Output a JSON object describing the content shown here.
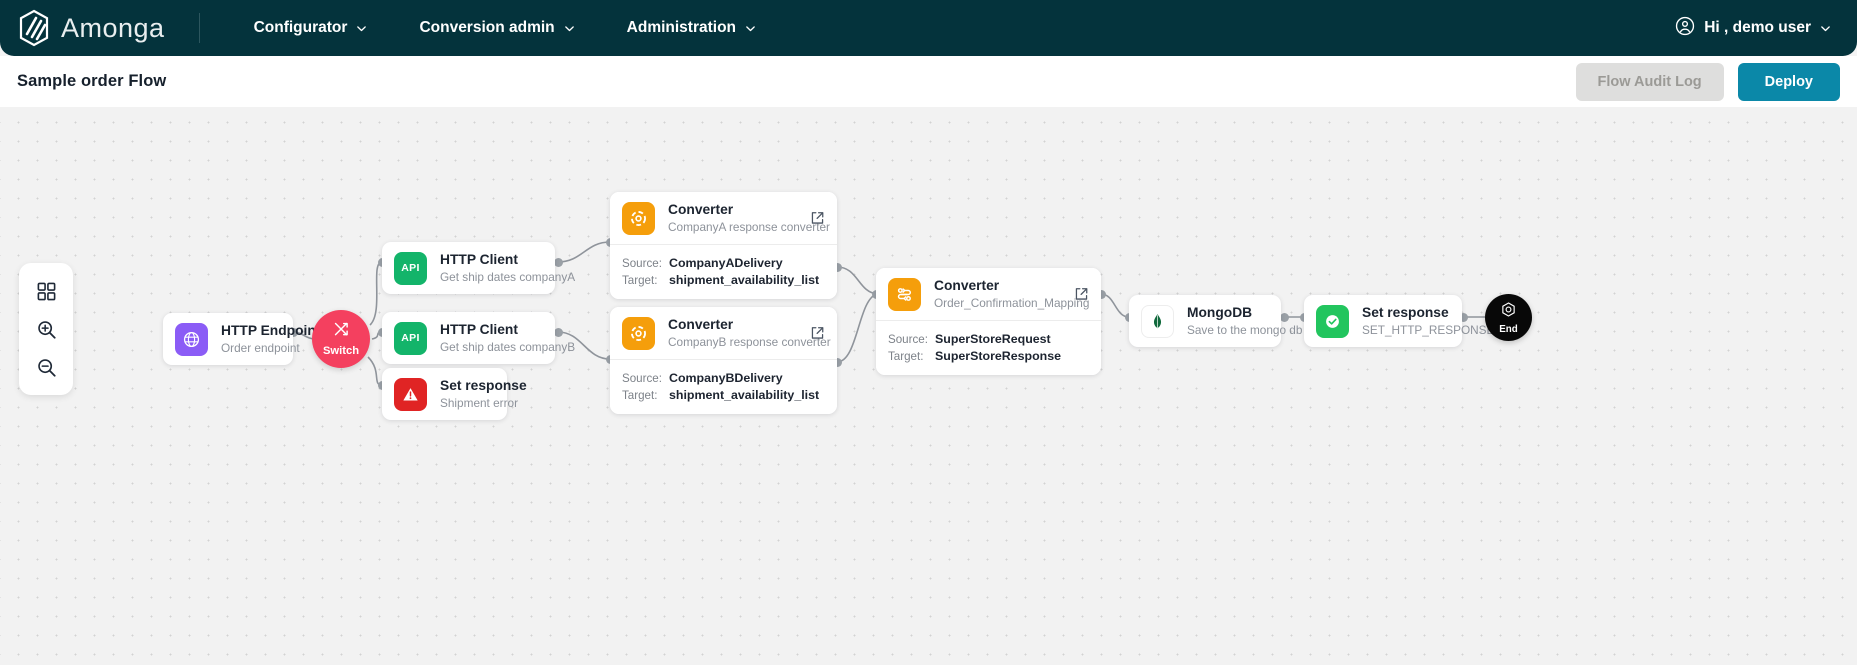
{
  "topbar": {
    "brand": "Amonga",
    "nav": [
      {
        "label": "Configurator",
        "icon": "chevron-down-icon"
      },
      {
        "label": "Conversion admin",
        "icon": "chevron-down-icon"
      },
      {
        "label": "Administration",
        "icon": "chevron-down-icon"
      }
    ],
    "user": {
      "label": "Hi , demo user",
      "icon": "user-circle-icon",
      "caret": "chevron-down-icon"
    },
    "bg_color": "#04333c"
  },
  "subheader": {
    "title": "Sample order Flow",
    "audit_label": "Flow Audit Log",
    "deploy_label": "Deploy",
    "deploy_color": "#0b88a8",
    "audit_color": "#dededd"
  },
  "tools": [
    {
      "name": "grid-icon",
      "label": "grid"
    },
    {
      "name": "zoom-in-icon",
      "label": "zoom in"
    },
    {
      "name": "zoom-out-icon",
      "label": "zoom out"
    }
  ],
  "nodes": {
    "http_endpoint": {
      "title": "HTTP Endpoint",
      "subtitle": "Order endpoint",
      "icon": "globe-icon",
      "color": "#8b5cf6"
    },
    "switch": {
      "label": "Switch",
      "icon": "switch-arrows-icon",
      "color": "#f4405f"
    },
    "http_client_a": {
      "title": "HTTP Client",
      "subtitle": "Get ship dates companyA",
      "icon": "api-icon",
      "color": "#13b46a"
    },
    "http_client_b": {
      "title": "HTTP Client",
      "subtitle": "Get ship dates companyB",
      "icon": "api-icon",
      "color": "#13b46a"
    },
    "set_response_error": {
      "title": "Set response",
      "subtitle": "Shipment error",
      "icon": "warning-triangle-icon",
      "color": "#e02424"
    },
    "converter_a": {
      "title": "Converter",
      "subtitle": "CompanyA response converter",
      "icon": "converter-gear-icon",
      "color": "#f59e0b",
      "link_icon": "external-link-icon",
      "source_label": "Source:",
      "source_value": "CompanyADelivery",
      "target_label": "Target:",
      "target_value": "shipment_availability_list"
    },
    "converter_b": {
      "title": "Converter",
      "subtitle": "CompanyB response converter",
      "icon": "converter-gear-icon",
      "color": "#f59e0b",
      "link_icon": "external-link-icon",
      "source_label": "Source:",
      "source_value": "CompanyBDelivery",
      "target_label": "Target:",
      "target_value": "shipment_availability_list"
    },
    "converter_c": {
      "title": "Converter",
      "subtitle": "Order_Confirmation_Mapping",
      "icon": "converter-swap-icon",
      "color": "#f59e0b",
      "link_icon": "external-link-icon",
      "source_label": "Source:",
      "source_value": "SuperStoreRequest",
      "target_label": "Target:",
      "target_value": "SuperStoreResponse"
    },
    "mongodb": {
      "title": "MongoDB",
      "subtitle": "Save to the mongo db",
      "icon": "mongodb-leaf-icon",
      "color": "#ffffff"
    },
    "set_response_http": {
      "title": "Set response",
      "subtitle": "SET_HTTP_RESPONSE",
      "icon": "check-circle-icon",
      "color": "#22c55e"
    },
    "end": {
      "label": "End",
      "icon": "target-hex-icon",
      "color": "#080808"
    }
  }
}
